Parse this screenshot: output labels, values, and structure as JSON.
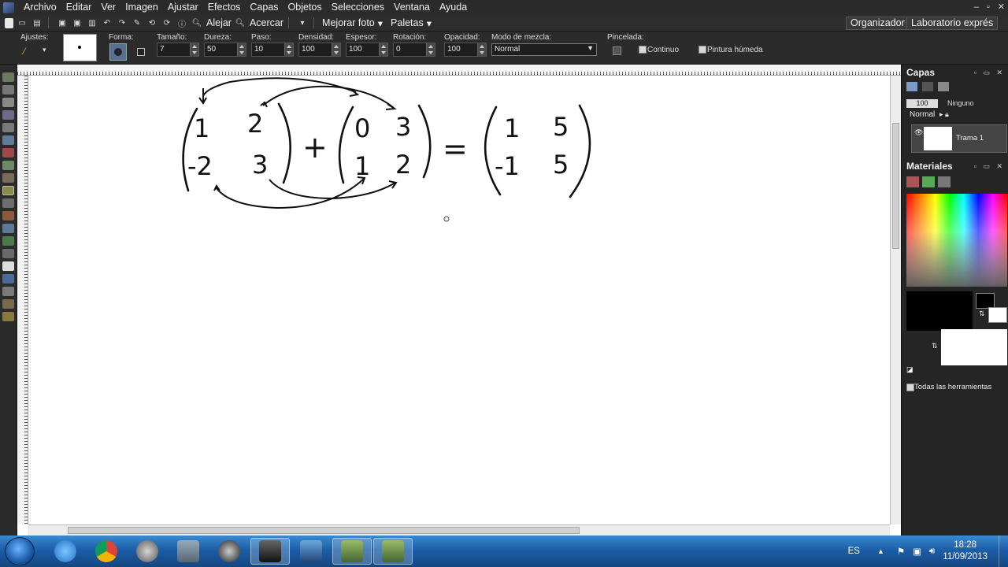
{
  "menu": {
    "items": [
      "Archivo",
      "Editar",
      "Ver",
      "Imagen",
      "Ajustar",
      "Efectos",
      "Capas",
      "Objetos",
      "Selecciones",
      "Ventana",
      "Ayuda"
    ]
  },
  "toolbar": {
    "zoom_out": "Alejar",
    "zoom_in": "Acercar",
    "enhance": "Mejorar foto",
    "palettes": "Paletas",
    "organizer": "Organizador",
    "express_lab": "Laboratorio exprés"
  },
  "options": {
    "presets_label": "Ajustes:",
    "shape_label": "Forma:",
    "size_label": "Tamaño:",
    "size_value": "7",
    "hardness_label": "Dureza:",
    "hardness_value": "50",
    "step_label": "Paso:",
    "step_value": "10",
    "density_label": "Densidad:",
    "density_value": "100",
    "thickness_label": "Espesor:",
    "thickness_value": "100",
    "rotation_label": "Rotación:",
    "rotation_value": "0",
    "opacity_label": "Opacidad:",
    "opacity_value": "100",
    "blend_label": "Modo de mezcla:",
    "blend_value": "Normal",
    "stroke_label": "Pincelada:",
    "continuous_label": "Continuo",
    "wet_label": "Pintura húmeda"
  },
  "canvas": {
    "matrix_a": [
      "1",
      "2",
      "-2",
      "3"
    ],
    "matrix_b": [
      "0",
      "3",
      "1",
      "2"
    ],
    "matrix_c": [
      "1",
      "5",
      "-1",
      "5"
    ],
    "plus": "+",
    "equals": "="
  },
  "layers_panel": {
    "title": "Capas",
    "opacity": "100",
    "none_label": "Ninguno",
    "blend": "Normal",
    "layer_name": "Trama 1"
  },
  "materials_panel": {
    "title": "Materiales",
    "all_tools_label": "Todas las herramientas",
    "foreground": "#000000",
    "background": "#ffffff"
  },
  "taskbar": {
    "language": "ES",
    "time": "18:28",
    "date": "11/09/2013"
  }
}
